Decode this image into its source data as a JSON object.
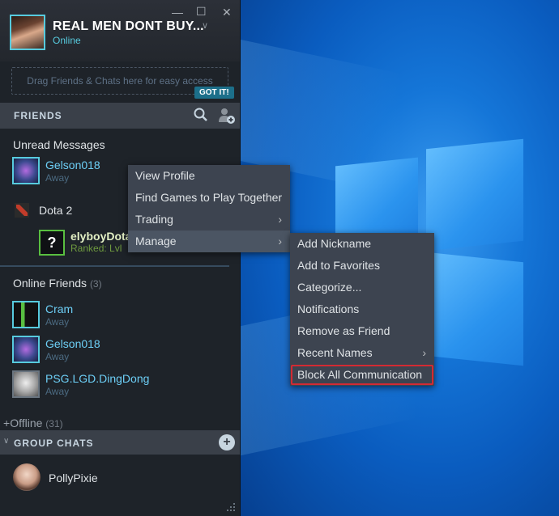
{
  "window": {
    "username": "REAL MEN DONT BUY...",
    "status": "Online",
    "controls": [
      "—",
      "☐",
      "✕"
    ]
  },
  "dragzone": {
    "text": "Drag Friends & Chats here for easy access",
    "got_it": "GOT IT!"
  },
  "friends_bar": {
    "title": "FRIENDS"
  },
  "unread": {
    "title": "Unread Messages",
    "friend": {
      "name": "Gelson018",
      "status": "Away"
    }
  },
  "dota": {
    "game": "Dota 2",
    "friend": {
      "name": "elyboyDota",
      "status": "Ranked: Lvl"
    }
  },
  "online": {
    "title": "Online Friends",
    "count": "(3)",
    "friends": [
      {
        "name": "Cram",
        "status": "Away"
      },
      {
        "name": "Gelson018",
        "status": "Away"
      },
      {
        "name": "PSG.LGD.DingDong",
        "status": "Away"
      }
    ]
  },
  "offline": {
    "title": "Offline",
    "count": "(31)"
  },
  "group_chats": {
    "title": "GROUP CHATS",
    "items": [
      {
        "name": "PollyPixie"
      }
    ]
  },
  "context_menu": {
    "items": [
      "View Profile",
      "Find Games to Play Together",
      "Trading",
      "Manage"
    ]
  },
  "manage_submenu": {
    "items": [
      "Add Nickname",
      "Add to Favorites",
      "Categorize...",
      "Notifications",
      "Remove as Friend",
      "Recent Names",
      "Block All Communication"
    ]
  },
  "colors": {
    "accent_online": "#57cbde",
    "ingame": "#59bf40",
    "highlight_border": "#d42a33"
  }
}
